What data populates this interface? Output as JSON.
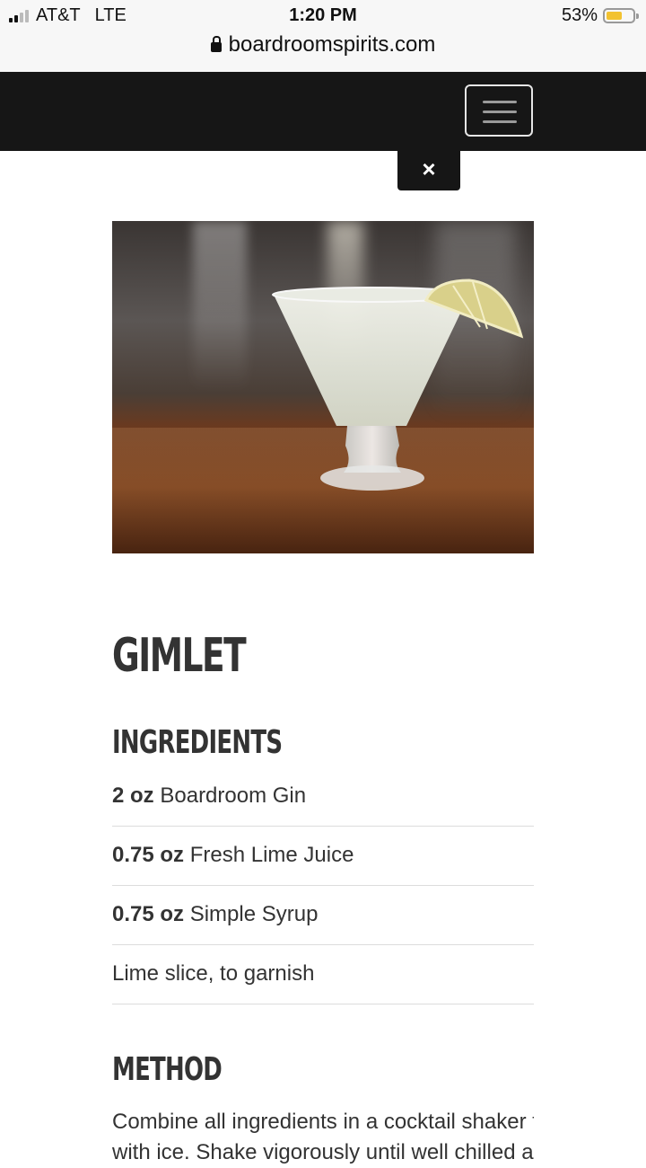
{
  "status_bar": {
    "carrier": "AT&T",
    "network": "LTE",
    "time": "1:20 PM",
    "battery_percent": "53%",
    "battery_level": 0.53
  },
  "browser": {
    "url": "boardroomspirits.com"
  },
  "nav": {
    "close_symbol": "×"
  },
  "recipe": {
    "title": "GIMLET",
    "ingredients_heading": "INGREDIENTS",
    "ingredients": [
      {
        "amount": "2 oz",
        "name": "Boardroom Gin"
      },
      {
        "amount": "0.75 oz",
        "name": "Fresh Lime Juice"
      },
      {
        "amount": "0.75 oz",
        "name": "Simple Syrup"
      },
      {
        "amount": "",
        "name": "Lime slice, to garnish"
      }
    ],
    "method_heading": "METHOD",
    "method_line1": "Combine all ingredients in a cocktail shaker fi",
    "method_line2": "with ice. Shake vigorously until well chilled an"
  },
  "colors": {
    "nav_bg": "#161616",
    "battery_fill": "#f2c230",
    "text": "#333333"
  }
}
